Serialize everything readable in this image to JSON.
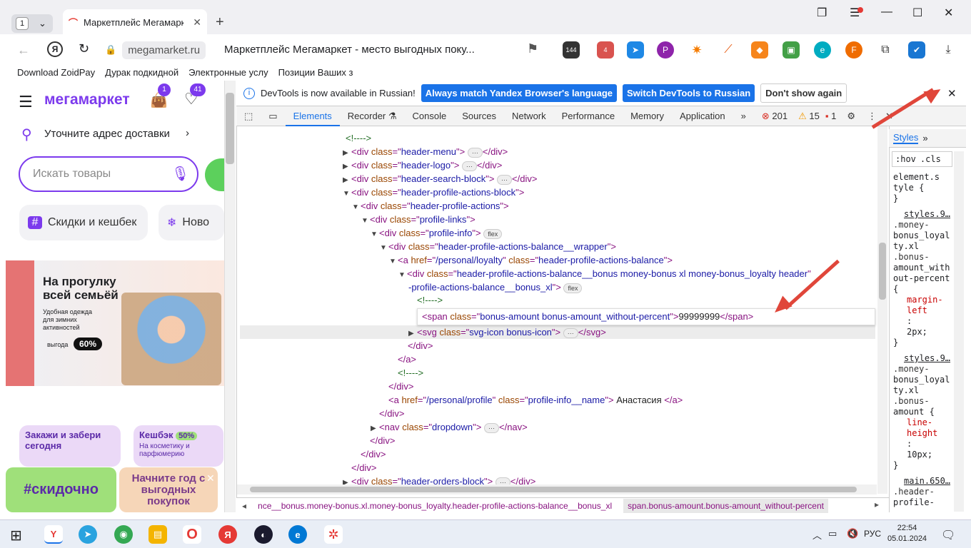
{
  "browser": {
    "tab_count": "1",
    "tab_title": "Маркетплейс Мегамаркет",
    "url_host": "megamarket.ru",
    "page_title": "Маркетплейс Мегамаркет - место выгодных поку...",
    "ext_badge_144": "144",
    "ext_badge_4": "4",
    "bookmarks": [
      "Download ZoidPay",
      "Дурак подкидной",
      "Электронные услу",
      "Позиции Ваших з"
    ]
  },
  "site": {
    "logo": "мегамаркет",
    "cart_badge": "1",
    "fav_badge": "41",
    "address_prompt": "Уточните адрес доставки",
    "search_placeholder": "Искать товары",
    "chip1": "Скидки и кешбек",
    "chip2": "Ново",
    "banner_title": "На прогулку всей семьёй",
    "banner_sub": "Удобная одежда для зимних активностей",
    "banner_badge_label": "выгода",
    "banner_badge_value": "60%",
    "promo1": "Закажи и забери сегодня",
    "promo2_title": "Кешбэк",
    "promo2_badge": "50%",
    "promo2_sub": "На косметику и парфюмерию",
    "green_block": "#скидочно",
    "peach_block": "Начните год с выгодных покупок"
  },
  "devtools": {
    "info_text": "DevTools is now available in Russian!",
    "btn_match": "Always match Yandex Browser's language",
    "btn_switch": "Switch DevTools to Russian",
    "btn_dont": "Don't show again",
    "tabs": [
      "Elements",
      "Recorder",
      "Console",
      "Sources",
      "Network",
      "Performance",
      "Memory",
      "Application"
    ],
    "errors": "201",
    "warnings": "15",
    "info": "1",
    "styles_tab": "Styles",
    "hov": ":hov",
    "cls": ".cls",
    "breadcrumb1": "nce__bonus.money-bonus.xl.money-bonus_loyalty.header-profile-actions-balance__bonus_xl",
    "breadcrumb2": "span.bonus-amount.bonus-amount_without-percent",
    "edit_value": "99999999",
    "name_text": " Анастасия "
  },
  "styles_pane": [
    "element.s",
    "tyle {",
    "}",
    "styles.9…",
    ".money-",
    "bonus_loyal",
    "ty.xl",
    ".bonus-",
    "amount_with",
    "out-percent",
    "{",
    "margin-",
    "left",
    ":",
    "2px;",
    "}",
    "styles.9…",
    ".money-",
    "bonus_loyal",
    "ty.xl",
    ".bonus-",
    "amount {",
    "line-",
    "height",
    ":",
    "10px;",
    "}",
    "main.650…",
    ".header-",
    "profile-"
  ],
  "taskbar": {
    "lang": "РУС",
    "time": "22:54",
    "date": "05.01.2024"
  }
}
